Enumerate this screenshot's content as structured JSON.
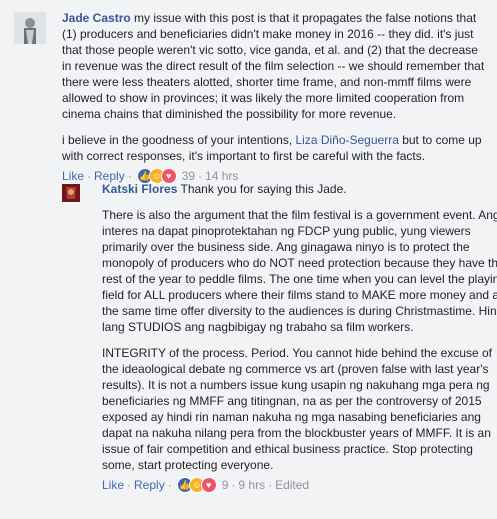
{
  "comment1": {
    "author": "Jade Castro",
    "text_p1": "my issue with this post is that it propagates the false notions that (1) producers and beneficiaries didn't make money in 2016 -- they did. it's just that those people weren't vic sotto, vice ganda, et al. and (2) that the decrease in revenue was the direct result of the film selection -- we should remember that there were less theaters alotted, shorter time frame, and non-mmff films were allowed to show in provinces; it was likely the more limited cooperation from cinema chains that diminished the possibility for more revenue.",
    "text_p2_before": "i believe in the goodness of your intentions, ",
    "mention": "Liza Diño-Seguerra",
    "text_p2_after": " but to come up with correct responses, it's important to first be careful with the facts.",
    "actions": {
      "like": "Like",
      "reply": "Reply",
      "sep": "·",
      "reactions": "39",
      "time": "14 hrs"
    }
  },
  "comment2": {
    "author": "Katski Flores",
    "lead": "Thank you for saying this Jade.",
    "para1": "There is also the argument that the film festival is a government event. Ang interes na dapat pinoprotektahan ng FDCP yung public, yung viewers primarily over the business side. Ang ginagawa ninyo is to protect the monopoly of producers who do NOT need protection because they have the rest of the year to peddle films. The one time when you can level the playing field for ALL producers where their films stand to MAKE more money and at the same time offer diversity to the audiences is during Christmastime. Hindi lang STUDIOS ang nagbibigay ng trabaho sa film workers.",
    "para2": "INTEGRITY of the process. Period. You cannot hide behind the excuse of the ideaological debate ng commerce vs art (proven false with last year's results). It is not a numbers issue kung usapin ng nakuhang mga pera ng beneficiaries ng MMFF ang titingnan, na as per the controversy of 2015 exposed ay hindi rin naman nakuha ng mga nasabing beneficiaries ang dapat na nakuha nilang pera from the blockbuster years of MMFF. It is an issue of fair competition and ethical business practice. Stop protecting some, start protecting everyone.",
    "actions": {
      "like": "Like",
      "reply": "Reply",
      "sep": "·",
      "reactions": "9",
      "time": "9 hrs",
      "edited": "Edited"
    }
  }
}
